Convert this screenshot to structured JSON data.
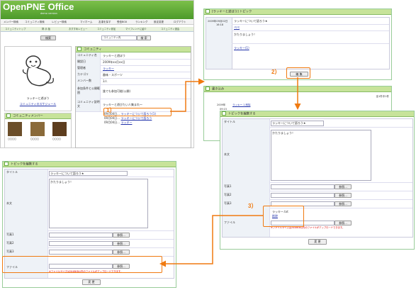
{
  "logo": {
    "title": "OpenPNE Office",
    "subtitle": "demo version"
  },
  "topnav": {
    "items": [
      "メンバー検索",
      "コミュニティ検索",
      "レビュー検索"
    ]
  },
  "icons_nav": {
    "items": [
      "マイホーム",
      "友達を探す",
      "受信BOX",
      "ランキング",
      "設定変更",
      "ログアウト"
    ]
  },
  "tabs": {
    "items": [
      "コミュニティトップ",
      "掲 示 板",
      "おすすめレビュー",
      "コミュニティ参加",
      "マイフレンドに紹介",
      "コミュニティ退会"
    ]
  },
  "search": {
    "button": "検索",
    "select": "コミュニティ内",
    "go": "検 索"
  },
  "community": {
    "name": "ラッキーと遊ぼう",
    "schedule_link": "コミュニティのスケジュール",
    "members_header": "コミュニティメンバー",
    "member_names": [
      "〇〇〇〇",
      "〇〇〇〇",
      "〇〇〇〇"
    ],
    "info_header": "コミュニティ",
    "rows": [
      {
        "label": "コミュニティ名",
        "value": "ラッキーと遊ぼう"
      },
      {
        "label": "開設日",
        "value": "2009年xx月xx日"
      },
      {
        "label": "管理者",
        "value": "ラッキー"
      },
      {
        "label": "カテゴリ",
        "value": "趣味・スポーツ"
      },
      {
        "label": "メンバー数",
        "value": "3人"
      },
      {
        "label": "参加条件と公開範囲",
        "value": "誰でも参加可能(公開)"
      },
      {
        "label": "コミュニティ説明文",
        "value": "ラッキーと遊びたい人集まれ〜"
      }
    ],
    "topics": [
      {
        "date": "09月04日…",
        "link": "ラッキーについて語ろう(1)"
      },
      {
        "date": "09月04日…",
        "link": "ラッキーについて語ろう"
      },
      {
        "date": "09月04日…",
        "link": "ラッキー"
      }
    ]
  },
  "topic_window": {
    "header": "[ラッキーと遊ぼう] トピック",
    "date": "2009年09月02日",
    "time": "16:18",
    "title": "ラッキーについて語ろう★",
    "author": "ぺぺ",
    "body": "かたりましょう！",
    "user_link": "ラッキー(1)",
    "edit_button": "編 集",
    "step_label": "2）"
  },
  "comment_window": {
    "header": "書き込み",
    "paging": "全1件中1件",
    "date": "2009年",
    "time": "09:15",
    "user": "ラッキー 1  削除"
  },
  "edit_window": {
    "header": "トピックを編集する",
    "title_label": "タイトル",
    "title_value": "ラッキーについて語ろう★",
    "body_label": "本文",
    "body_value": "かたりましょう！",
    "photo_labels": [
      "写真1",
      "写真2",
      "写真3"
    ],
    "browse": "参照...",
    "file_label": "ファイル",
    "file_current": "ラッキー.txt",
    "file_delete": "削除",
    "file_note": "※ファイルサイズは2048KB以内のファイルがアップロードできます。",
    "submit": "変 更",
    "step_label": "3）"
  },
  "bottom_window": {
    "header": "トピックを編集する",
    "title_label": "タイトル",
    "title_value": "ラッキーについて語ろう★",
    "body_label": "本文",
    "body_value": "かたりましょう！",
    "photo_labels": [
      "写真1",
      "写真2",
      "写真3"
    ],
    "browse": "参照...",
    "file_label": "ファイル",
    "file_note": "※ファイルサイズは2048KB以内のファイルがアップロードできます。",
    "submit": "変 更"
  },
  "step1_label": "1）",
  "colors": {
    "accent": "#f07a10",
    "header_green": "#c7e39a",
    "logo_green": "#6db33f"
  }
}
